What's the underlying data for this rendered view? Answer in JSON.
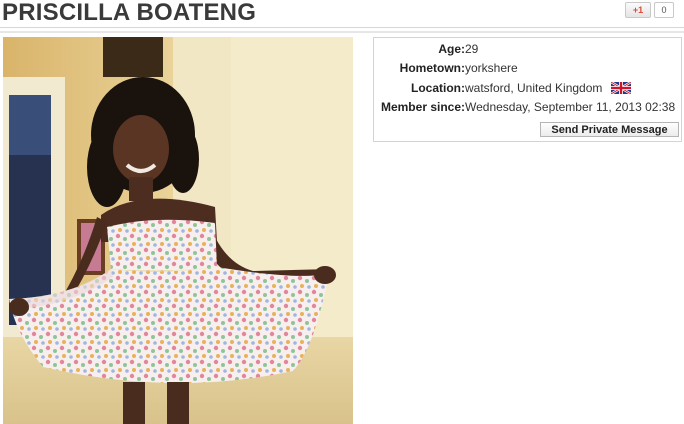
{
  "profile": {
    "name": "PRISCILLA BOATENG",
    "details": [
      {
        "label": "Age:",
        "value": "29"
      },
      {
        "label": "Hometown:",
        "value": "yorkshere"
      },
      {
        "label": "Location:",
        "value": "watsford, United Kingdom"
      },
      {
        "label": "Member since:",
        "value": "Wednesday, September 11, 2013 02:38"
      }
    ],
    "location_flag_icon": "uk-flag-icon",
    "send_message_label": "Send Private Message"
  },
  "share": {
    "gplus_label": "+1",
    "gplus_count": "0"
  }
}
